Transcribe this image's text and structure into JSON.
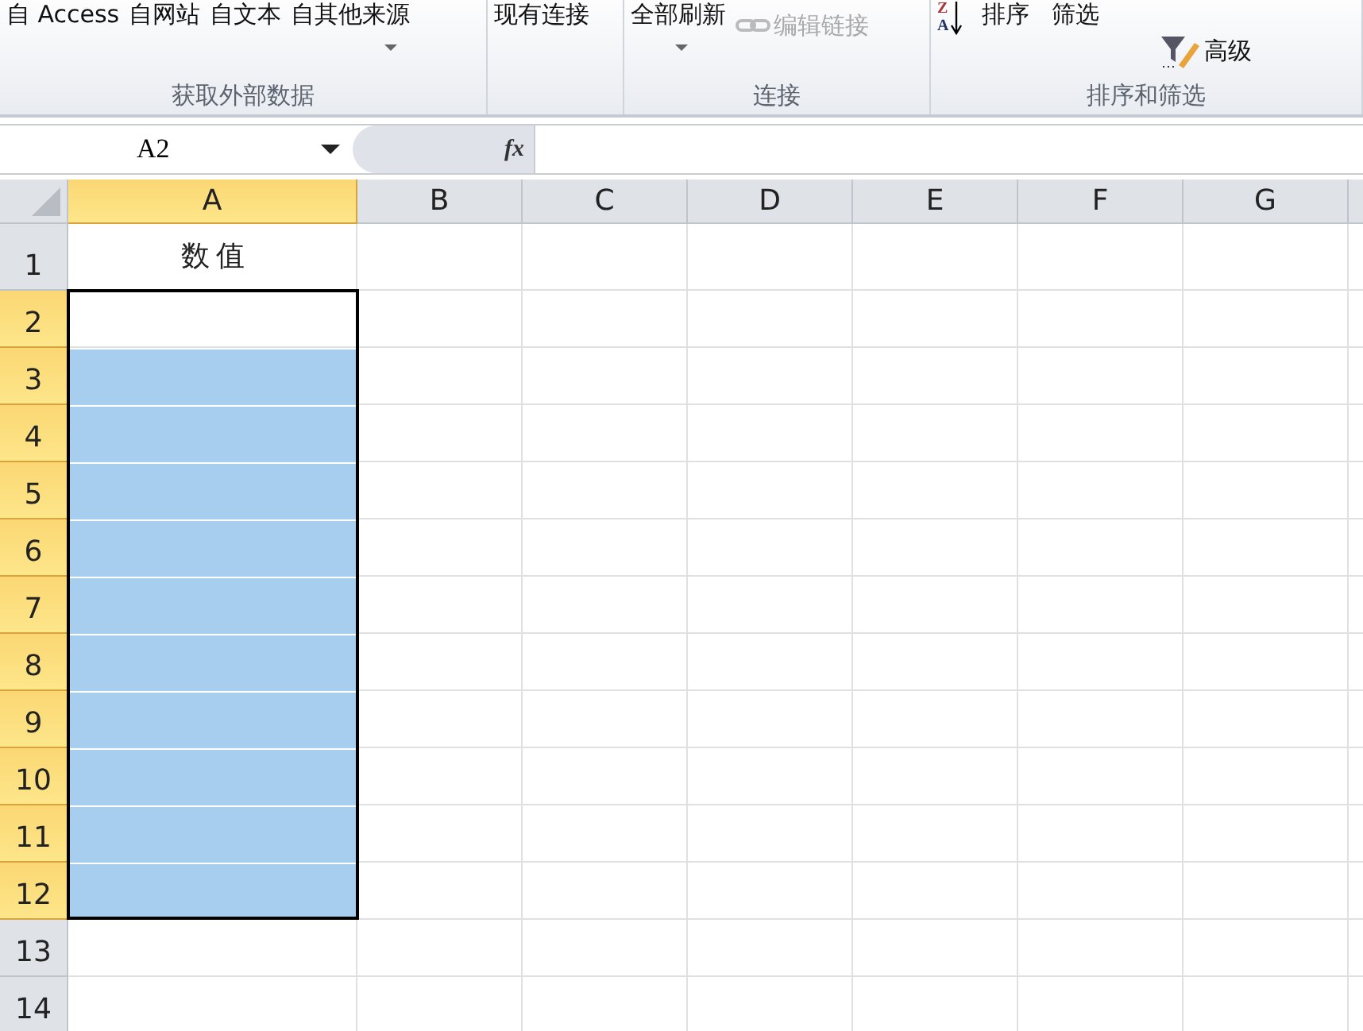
{
  "ribbon": {
    "groups": [
      {
        "label": "获取外部数据",
        "items": [
          {
            "kind": "button",
            "text": "自 Access"
          },
          {
            "kind": "button",
            "text": "自网站"
          },
          {
            "kind": "button",
            "text": "自文本"
          },
          {
            "kind": "dropdown",
            "text": "自其他来源"
          }
        ]
      },
      {
        "items": [
          {
            "kind": "button",
            "text": "现有连接"
          }
        ]
      },
      {
        "label": "连接",
        "items": [
          {
            "kind": "dropdown",
            "text": "全部刷新"
          },
          {
            "kind": "link",
            "text": "编辑链接",
            "disabled": true
          }
        ]
      },
      {
        "label": "排序和筛选",
        "items": [
          {
            "kind": "sort",
            "text": "排序",
            "icon_letters": [
              "Z",
              "A"
            ]
          },
          {
            "kind": "button",
            "text": "筛选"
          },
          {
            "kind": "advanced",
            "text": "高级"
          }
        ]
      }
    ]
  },
  "formula_bar": {
    "name_box": "A2",
    "fx": "fx"
  },
  "sheet": {
    "columns": [
      {
        "label": "A",
        "selected": true
      },
      {
        "label": "B",
        "selected": false
      },
      {
        "label": "C",
        "selected": false
      },
      {
        "label": "D",
        "selected": false
      },
      {
        "label": "E",
        "selected": false
      },
      {
        "label": "F",
        "selected": false
      },
      {
        "label": "G",
        "selected": false
      }
    ],
    "rows": [
      {
        "label": "1",
        "selected": false,
        "cells": [
          {
            "text": "数值",
            "selected": false
          }
        ]
      },
      {
        "label": "2",
        "selected": true,
        "cells": [
          {
            "selected": false
          }
        ]
      },
      {
        "label": "3",
        "selected": true,
        "cells": [
          {
            "selected": true
          }
        ]
      },
      {
        "label": "4",
        "selected": true,
        "cells": [
          {
            "selected": true
          }
        ]
      },
      {
        "label": "5",
        "selected": true,
        "cells": [
          {
            "selected": true
          }
        ]
      },
      {
        "label": "6",
        "selected": true,
        "cells": [
          {
            "selected": true
          }
        ]
      },
      {
        "label": "7",
        "selected": true,
        "cells": [
          {
            "selected": true
          }
        ]
      },
      {
        "label": "8",
        "selected": true,
        "cells": [
          {
            "selected": true
          }
        ]
      },
      {
        "label": "9",
        "selected": true,
        "cells": [
          {
            "selected": true
          }
        ]
      },
      {
        "label": "10",
        "selected": true,
        "cells": [
          {
            "selected": true
          }
        ]
      },
      {
        "label": "11",
        "selected": true,
        "cells": [
          {
            "selected": true
          }
        ]
      },
      {
        "label": "12",
        "selected": true,
        "cells": [
          {
            "selected": true
          }
        ]
      },
      {
        "label": "13",
        "selected": false,
        "cells": [
          {
            "selected": false
          }
        ]
      },
      {
        "label": "14",
        "selected": false,
        "cells": [
          {
            "selected": false
          }
        ]
      }
    ]
  }
}
